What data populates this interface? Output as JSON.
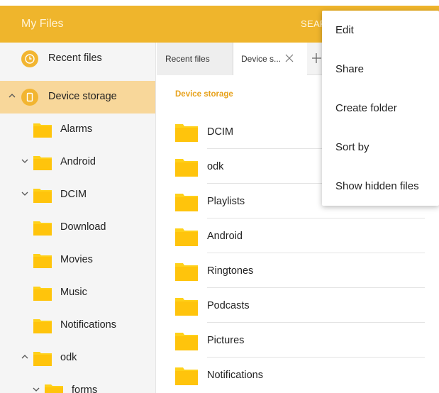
{
  "app": {
    "title": "My Files",
    "search_label": "SEAR"
  },
  "colors": {
    "accent": "#efb52c",
    "selected_bg": "#f8d79a",
    "folder": "#ffd11a",
    "crumb": "#e7a11a"
  },
  "sidebar": {
    "items": [
      {
        "label": "Recent files",
        "icon": "clock-icon"
      },
      {
        "label": "Device storage",
        "icon": "phone-icon",
        "chevron": "up",
        "selected": true
      },
      {
        "label": "Alarms",
        "icon": "folder-icon"
      },
      {
        "label": "Android",
        "icon": "folder-icon",
        "chevron": "down"
      },
      {
        "label": "DCIM",
        "icon": "folder-icon",
        "chevron": "down"
      },
      {
        "label": "Download",
        "icon": "folder-icon"
      },
      {
        "label": "Movies",
        "icon": "folder-icon"
      },
      {
        "label": "Music",
        "icon": "folder-icon"
      },
      {
        "label": "Notifications",
        "icon": "folder-icon"
      },
      {
        "label": "odk",
        "icon": "folder-icon",
        "chevron": "up"
      },
      {
        "label": "forms",
        "icon": "folder-icon",
        "chevron": "down"
      }
    ]
  },
  "tabs": [
    {
      "label": "Recent files"
    },
    {
      "label": "Device s...",
      "active": true
    }
  ],
  "content": {
    "breadcrumb": "Device storage",
    "folders": [
      "DCIM",
      "odk",
      "Playlists",
      "Android",
      "Ringtones",
      "Podcasts",
      "Pictures",
      "Notifications"
    ]
  },
  "menu": {
    "items": [
      "Edit",
      "Share",
      "Create folder",
      "Sort by",
      "Show hidden files"
    ]
  }
}
